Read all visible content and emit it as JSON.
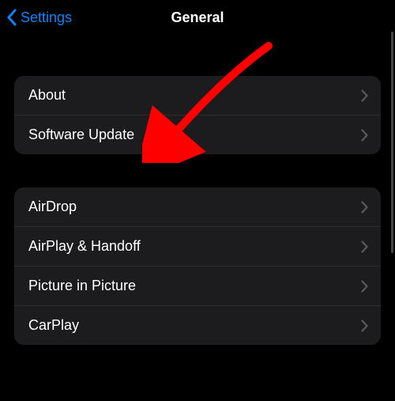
{
  "nav": {
    "back_label": "Settings",
    "title": "General"
  },
  "groups": [
    {
      "items": [
        {
          "label": "About",
          "name": "row-about"
        },
        {
          "label": "Software Update",
          "name": "row-software-update"
        }
      ]
    },
    {
      "items": [
        {
          "label": "AirDrop",
          "name": "row-airdrop"
        },
        {
          "label": "AirPlay & Handoff",
          "name": "row-airplay-handoff"
        },
        {
          "label": "Picture in Picture",
          "name": "row-picture-in-picture"
        },
        {
          "label": "CarPlay",
          "name": "row-carplay"
        }
      ]
    }
  ],
  "colors": {
    "accent": "#0a84ff",
    "cell_bg": "#1c1c1e",
    "arrow": "#ff0000"
  }
}
